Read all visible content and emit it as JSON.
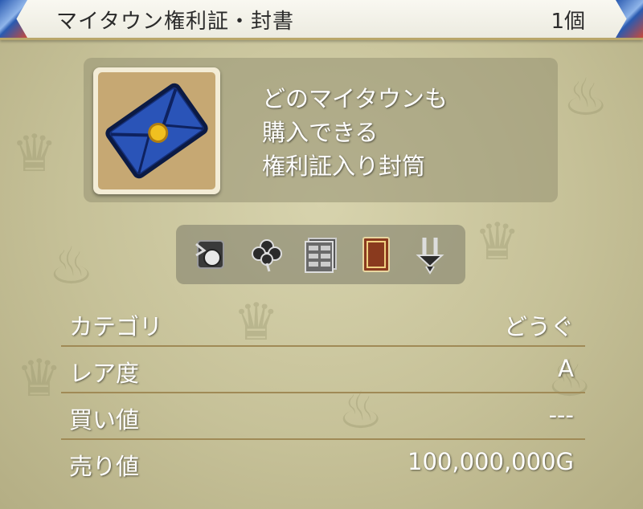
{
  "header": {
    "title": "マイタウン権利証・封書",
    "count": "1個"
  },
  "item": {
    "icon": "blue-envelope-icon",
    "description": [
      "どのマイタウンも",
      "購入できる",
      "権利証入り封筒"
    ]
  },
  "attributes": [
    {
      "icon": "bag-icon"
    },
    {
      "icon": "clover-icon"
    },
    {
      "icon": "cabinet-icon"
    },
    {
      "icon": "book-icon"
    },
    {
      "icon": "arrows-icon"
    }
  ],
  "stats": [
    {
      "label": "カテゴリ",
      "value": "どうぐ"
    },
    {
      "label": "レア度",
      "value": "A"
    },
    {
      "label": "買い値",
      "value": "---"
    },
    {
      "label": "売り値",
      "value": "100,000,000G"
    }
  ],
  "colors": {
    "accent_gold": "#b9a76a",
    "envelope_blue": "#1f3f9a",
    "seal_gold": "#f0c020"
  }
}
